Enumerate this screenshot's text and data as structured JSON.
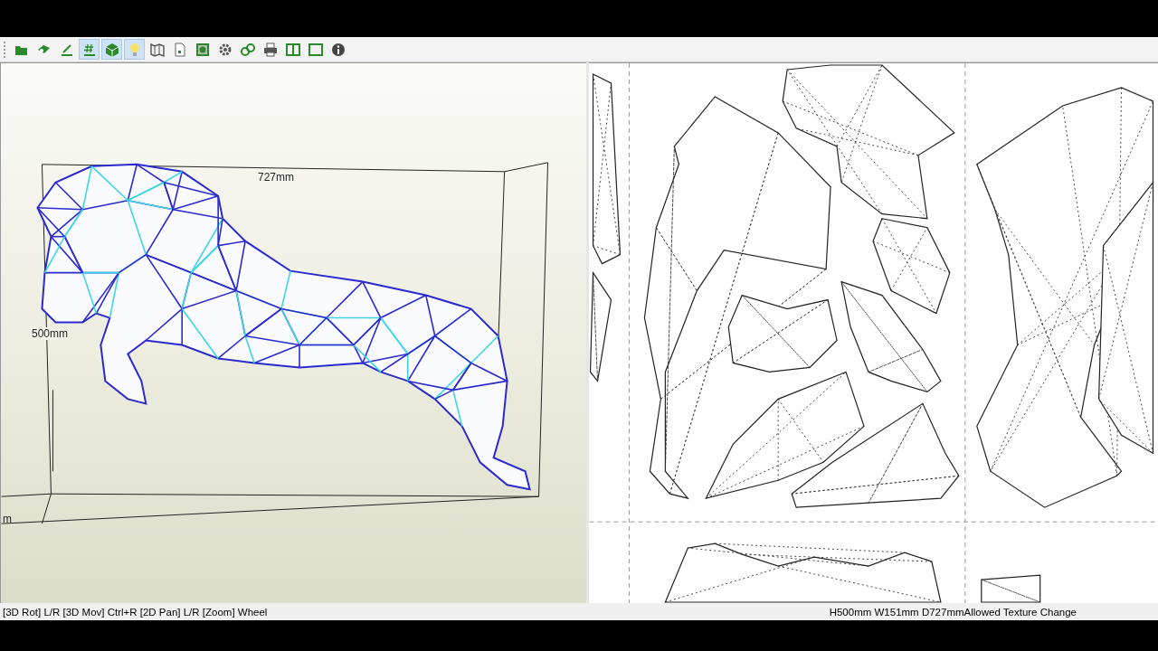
{
  "toolbar": {
    "buttons": [
      {
        "kind": "open",
        "selected": false
      },
      {
        "kind": "unfold",
        "selected": false
      },
      {
        "kind": "edit",
        "selected": false
      },
      {
        "kind": "grid",
        "selected": true
      },
      {
        "kind": "cube",
        "selected": true
      },
      {
        "kind": "bulb",
        "selected": true
      },
      {
        "kind": "map",
        "selected": false
      },
      {
        "kind": "page",
        "selected": false
      },
      {
        "kind": "fit",
        "selected": false
      },
      {
        "kind": "gear",
        "selected": false
      },
      {
        "kind": "link",
        "selected": false
      },
      {
        "kind": "print",
        "selected": false
      },
      {
        "kind": "split",
        "selected": false
      },
      {
        "kind": "window",
        "selected": false
      },
      {
        "kind": "info",
        "selected": false
      }
    ]
  },
  "view_3d": {
    "labels": [
      {
        "kind": "width",
        "text": "727mm"
      },
      {
        "kind": "height",
        "text": "500mm"
      },
      {
        "kind": "depth",
        "text": "m"
      }
    ]
  },
  "status_bar": {
    "hint": "[3D Rot] L/R [3D Mov] Ctrl+R [2D Pan] L/R [Zoom] Wheel",
    "size": "H500mm W151mm D727mm",
    "mode": "Allowed Texture Change"
  }
}
